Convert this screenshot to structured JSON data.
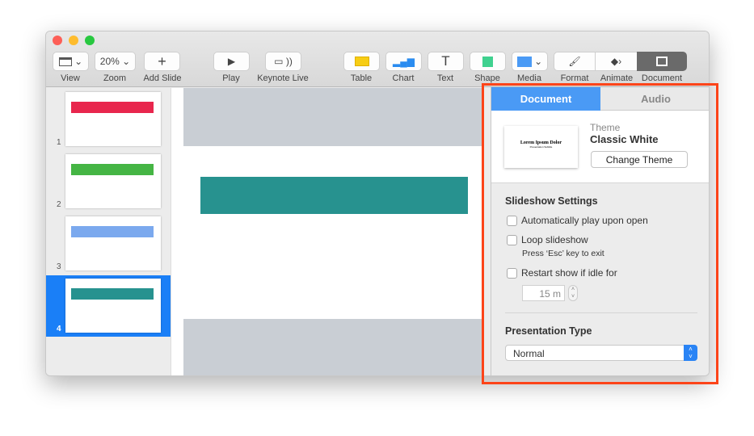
{
  "toolbar": {
    "view": "View",
    "zoom": "Zoom",
    "zoom_value": "20%",
    "add_slide": "Add Slide",
    "play": "Play",
    "keynote_live": "Keynote Live",
    "table": "Table",
    "chart": "Chart",
    "text": "Text",
    "shape": "Shape",
    "media": "Media",
    "format": "Format",
    "animate": "Animate",
    "document": "Document"
  },
  "slides": [
    {
      "number": "1",
      "color": "#e8264d"
    },
    {
      "number": "2",
      "color": "#45b544"
    },
    {
      "number": "3",
      "color": "#7ba9ee"
    },
    {
      "number": "4",
      "color": "#27928f"
    }
  ],
  "selected_slide": 4,
  "main_slide": {
    "shape_color": "#27928f"
  },
  "panel": {
    "tabs": [
      "Document",
      "Audio"
    ],
    "active_tab": "Document",
    "theme_label": "Theme",
    "theme_name": "Classic White",
    "theme_preview_title": "Lorem Ipsum Dolor",
    "theme_preview_subtitle": "Presentation Subtitle",
    "change_theme": "Change Theme",
    "slideshow_settings": "Slideshow Settings",
    "auto_play": "Automatically play upon open",
    "loop": "Loop slideshow",
    "loop_hint": "Press ‘Esc’ key to exit",
    "restart": "Restart show if idle for",
    "idle_value": "15 m",
    "presentation_type_label": "Presentation Type",
    "presentation_type": "Normal"
  },
  "colors": {
    "accent": "#4a9af5",
    "highlight": "#fc4419",
    "selection": "#1a7ff7"
  }
}
